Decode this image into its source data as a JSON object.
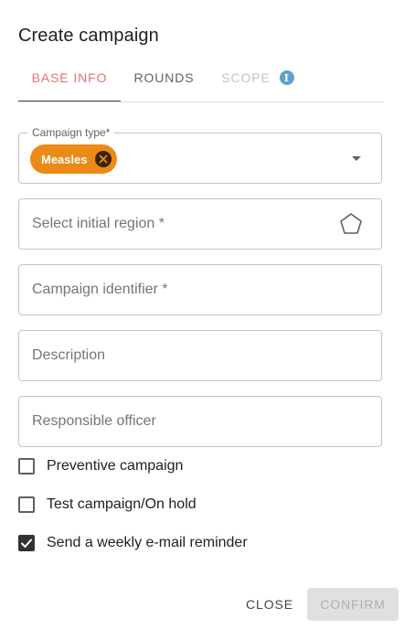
{
  "dialog": {
    "title": "Create campaign"
  },
  "tabs": [
    {
      "label": "BASE INFO",
      "state": "active"
    },
    {
      "label": "ROUNDS",
      "state": "normal"
    },
    {
      "label": "SCOPE",
      "state": "disabled",
      "icon": "info-icon"
    }
  ],
  "fields": {
    "campaign_type": {
      "label": "Campaign type*",
      "selected_chip": "Measles",
      "chip_color": "#ec8a17"
    },
    "initial_region": {
      "placeholder": "Select initial region *",
      "icon": "polygon-icon"
    },
    "campaign_identifier": {
      "placeholder": "Campaign identifier *"
    },
    "description": {
      "placeholder": "Description"
    },
    "responsible_officer": {
      "placeholder": "Responsible officer"
    }
  },
  "checkboxes": [
    {
      "label": "Preventive campaign",
      "checked": false
    },
    {
      "label": "Test campaign/On hold",
      "checked": false
    },
    {
      "label": "Send a weekly e-mail reminder",
      "checked": true
    }
  ],
  "actions": {
    "close_label": "CLOSE",
    "confirm_label": "CONFIRM",
    "confirm_enabled": false
  },
  "colors": {
    "active_tab": "#e57373",
    "info_icon": "#5fa1c9",
    "checkbox_checked": "#333333"
  }
}
